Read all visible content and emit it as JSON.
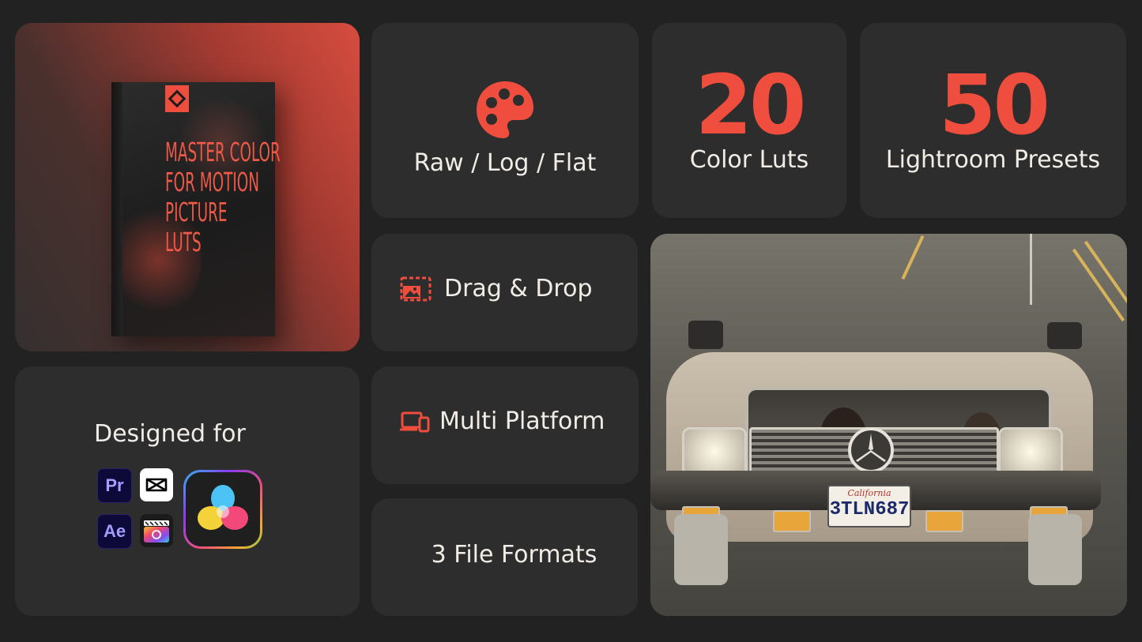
{
  "product": {
    "box_title_lines": [
      "MASTER COLOR",
      "FOR MOTION",
      "PICTURE",
      "LUTS"
    ]
  },
  "designed": {
    "label": "Designed for",
    "apps": [
      {
        "name": "premiere-pro",
        "label": "Pr"
      },
      {
        "name": "capcut",
        "label": ""
      },
      {
        "name": "after-effects",
        "label": "Ae"
      },
      {
        "name": "final-cut-pro",
        "label": ""
      },
      {
        "name": "davinci-resolve",
        "label": ""
      }
    ]
  },
  "features": {
    "raw_log_flat": {
      "icon": "palette-icon",
      "label": "Raw / Log / Flat"
    },
    "color_luts": {
      "number": "20",
      "label": "Color Luts"
    },
    "lightroom_presets": {
      "number": "50",
      "label": "Lightroom Presets"
    },
    "drag_drop": {
      "icon": "drag-drop-icon",
      "label": "Drag & Drop"
    },
    "multi_platform": {
      "icon": "devices-icon",
      "label": "Multi Platform"
    },
    "file_formats": {
      "label": "3 File Formats"
    }
  },
  "photo": {
    "plate_state": "California",
    "plate_number": "3TLN687"
  },
  "colors": {
    "accent": "#ef4d3e",
    "background": "#222222",
    "card": "#2d2d2d",
    "text": "#f2ece6"
  }
}
